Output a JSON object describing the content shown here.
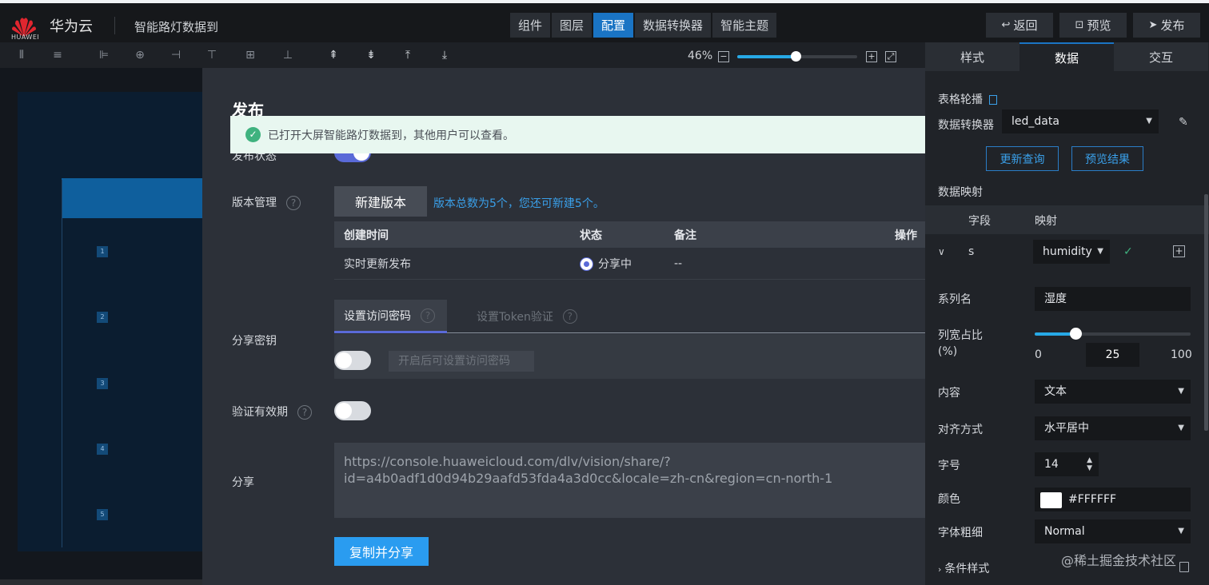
{
  "header": {
    "logo_text": "HUAWEI",
    "brand": "华为云",
    "project_name": "智能路灯数据到",
    "nav_tabs": [
      "组件",
      "图层",
      "配置",
      "数据转换器",
      "智能主题"
    ],
    "active_tab": "配置",
    "back_label": "返回",
    "preview_label": "预览",
    "publish_label": "发布"
  },
  "toolbar": {
    "zoom_level": "46%",
    "zoom_fraction": 0.46
  },
  "canvas": {
    "row_numbers": [
      "1",
      "2",
      "3",
      "4",
      "5"
    ]
  },
  "publish": {
    "title": "发布",
    "notice": "已打开大屏智能路灯数据到，其他用户可以查看。",
    "status_label": "发布状态",
    "version_label": "版本管理",
    "new_version_button": "新建版本",
    "version_count_text": "版本总数为5个，您还可新建5个。",
    "table_headers": [
      "创建时间",
      "状态",
      "备注",
      "操作"
    ],
    "table_rows": [
      {
        "created": "实时更新发布",
        "status": "分享中",
        "remark": "--"
      }
    ],
    "share_key_label": "分享密钥",
    "key_tabs": [
      "设置访问密码",
      "设置Token验证"
    ],
    "password_placeholder": "开启后可设置访问密码",
    "validity_label": "验证有效期",
    "share_label": "分享",
    "share_url": "https://console.huaweicloud.com/dlv/vision/share/?id=a4b0adf1d0d94b29aafd53fda4a3d0cc&locale=zh-cn&region=cn-north-1",
    "copy_button": "复制并分享"
  },
  "right_panel": {
    "tabs": [
      "样式",
      "数据",
      "交互"
    ],
    "active_tab": "数据",
    "component_name": "表格轮播",
    "converter_label": "数据转换器",
    "converter_value": "led_data",
    "update_query_button": "更新查询",
    "preview_result_button": "预览结果",
    "mapping_label": "数据映射",
    "mapping_headers": [
      "字段",
      "映射"
    ],
    "mapping_field": "s",
    "mapping_value": "humidity",
    "series_name_label": "系列名",
    "series_name_value": "湿度",
    "col_width_label": "列宽占比",
    "col_width_unit": "(%)",
    "col_width_min": "0",
    "col_width_value": "25",
    "col_width_max": "100",
    "content_label": "内容",
    "content_value": "文本",
    "align_label": "对齐方式",
    "align_value": "水平居中",
    "font_size_label": "字号",
    "font_size_value": "14",
    "color_label": "颜色",
    "color_value": "#FFFFFF",
    "font_weight_label": "字体粗细",
    "font_weight_value": "Normal",
    "condition_style_label": "条件样式"
  },
  "watermark": "@稀土掘金技术社区"
}
